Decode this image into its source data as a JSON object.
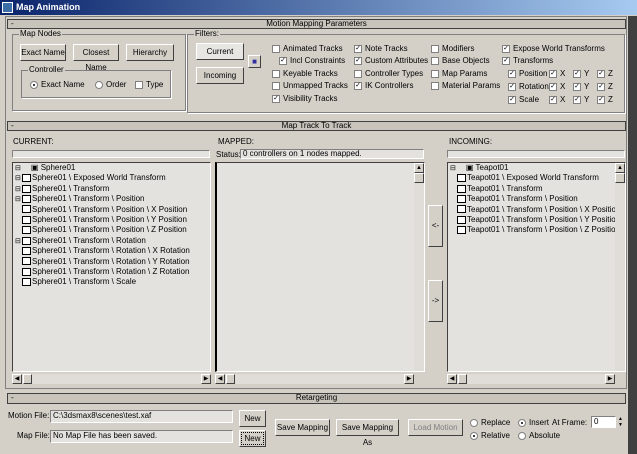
{
  "window": {
    "title": "Map Animation"
  },
  "motion_mapping": {
    "header": "Motion Mapping Parameters",
    "collapse": "-",
    "map_nodes": {
      "label": "Map Nodes",
      "buttons": [
        "Exact Name",
        "Closest Name",
        "Hierarchy"
      ],
      "controller": {
        "label": "Controller",
        "exact_name": "Exact Name",
        "order": "Order",
        "type": "Type",
        "selected": "Exact Name",
        "type_checked": false
      }
    },
    "filters": {
      "label": "Filters:",
      "current": "Current",
      "incoming": "Incoming",
      "lock_icon": "lock-icon",
      "checks": [
        {
          "label": "Animated Tracks",
          "checked": false
        },
        {
          "label": "Incl Constraints",
          "checked": true
        },
        {
          "label": "Keyable Tracks",
          "checked": false
        },
        {
          "label": "Unmapped Tracks",
          "checked": false
        },
        {
          "label": "Visibility Tracks",
          "checked": true
        },
        {
          "label": "Note Tracks",
          "checked": true
        },
        {
          "label": "Custom Attributes",
          "checked": true
        },
        {
          "label": "Controller Types",
          "checked": false
        },
        {
          "label": "IK Controllers",
          "checked": true
        },
        {
          "label": "Modifiers",
          "checked": false
        },
        {
          "label": "Base Objects",
          "checked": false
        },
        {
          "label": "Map Params",
          "checked": false
        },
        {
          "label": "Material Params",
          "checked": false
        },
        {
          "label": "Expose World Transforms",
          "checked": true
        },
        {
          "label": "Transforms",
          "checked": true
        }
      ],
      "transform_rows": [
        {
          "label": "Position",
          "checked": true
        },
        {
          "label": "Rotation",
          "checked": true
        },
        {
          "label": "Scale",
          "checked": true
        }
      ],
      "axes": [
        "X",
        "Y",
        "Z"
      ]
    }
  },
  "map_track": {
    "header": "Map Track To Track",
    "collapse": "-",
    "current": {
      "label": "CURRENT:",
      "filter": "",
      "root": "Sphere01",
      "items": [
        "Sphere01 \\ Exposed World Transform",
        "Sphere01 \\ Transform",
        "Sphere01 \\ Transform \\ Position",
        "Sphere01 \\ Transform \\ Position \\ X Position",
        "Sphere01 \\ Transform \\ Position \\ Y Position",
        "Sphere01 \\ Transform \\ Position \\ Z Position",
        "Sphere01 \\ Transform \\ Rotation",
        "Sphere01 \\ Transform \\ Rotation \\ X Rotation",
        "Sphere01 \\ Transform \\ Rotation \\ Y Rotation",
        "Sphere01 \\ Transform \\ Rotation \\ Z Rotation",
        "Sphere01 \\ Transform \\ Scale"
      ]
    },
    "mapped": {
      "label": "MAPPED:",
      "status_label": "Status:",
      "status": "0 controllers on 1 nodes mapped."
    },
    "move_left": "<-",
    "move_right": "->",
    "incoming": {
      "label": "INCOMING:",
      "filter": "",
      "root": "Teapot01",
      "items": [
        "Teapot01 \\ Exposed World Transform",
        "Teapot01 \\ Transform",
        "Teapot01 \\ Transform \\ Position",
        "Teapot01 \\ Transform \\ Position \\ X Position",
        "Teapot01 \\ Transform \\ Position \\ Y Position",
        "Teapot01 \\ Transform \\ Position \\ Z Position"
      ]
    }
  },
  "retargeting": {
    "header": "Retargeting",
    "collapse": "-",
    "motion_file_label": "Motion File:",
    "motion_file": "C:\\3dsmax8\\scenes\\test.xaf",
    "new1": "New",
    "map_file_label": "Map File:",
    "map_file": "No Map File has been saved.",
    "new2": "New",
    "save_mapping": "Save Mapping",
    "save_mapping_as": "Save Mapping As",
    "load_motion": "Load Motion",
    "replace": "Replace",
    "insert": "Insert",
    "mode": "Insert",
    "at_frame_label": "At Frame:",
    "at_frame": "0",
    "relative": "Relative",
    "absolute": "Absolute",
    "position_mode": "Relative"
  }
}
